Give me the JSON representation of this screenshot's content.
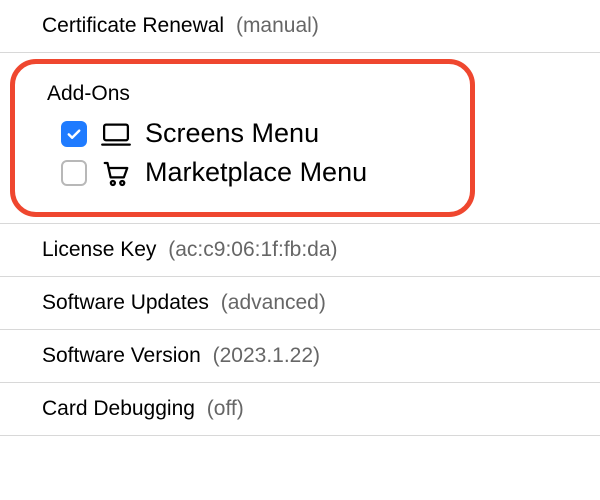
{
  "rows": {
    "certificate_renewal": {
      "label": "Certificate Renewal",
      "value": "manual"
    },
    "license_key": {
      "label": "License Key",
      "value": "ac:c9:06:1f:fb:da"
    },
    "software_updates": {
      "label": "Software Updates",
      "value": "advanced"
    },
    "software_version": {
      "label": "Software Version",
      "value": "2023.1.22"
    },
    "card_debugging": {
      "label": "Card Debugging",
      "value": "off"
    }
  },
  "addons": {
    "title": "Add-Ons",
    "items": [
      {
        "label": "Screens Menu",
        "checked": true,
        "icon": "screen-icon"
      },
      {
        "label": "Marketplace Menu",
        "checked": false,
        "icon": "cart-icon"
      }
    ]
  }
}
